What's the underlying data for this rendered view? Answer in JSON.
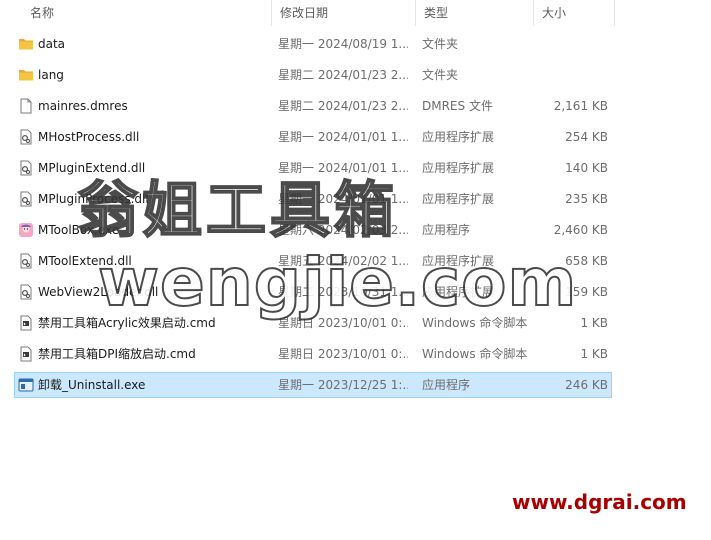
{
  "columns": {
    "name": "名称",
    "date": "修改日期",
    "type": "类型",
    "size": "大小"
  },
  "files": [
    {
      "name": "data",
      "date": "星期一 2024/08/19 1...",
      "type": "文件夹",
      "size": "",
      "icon": "folder-icon"
    },
    {
      "name": "lang",
      "date": "星期二 2024/01/23 2...",
      "type": "文件夹",
      "size": "",
      "icon": "folder-icon"
    },
    {
      "name": "mainres.dmres",
      "date": "星期二 2024/01/23 2...",
      "type": "DMRES 文件",
      "size": "2,161 KB",
      "icon": "file-icon"
    },
    {
      "name": "MHostProcess.dll",
      "date": "星期一 2024/01/01 1...",
      "type": "应用程序扩展",
      "size": "254 KB",
      "icon": "dll-icon"
    },
    {
      "name": "MPluginExtend.dll",
      "date": "星期一 2024/01/01 1...",
      "type": "应用程序扩展",
      "size": "140 KB",
      "icon": "dll-icon"
    },
    {
      "name": "MPluginProcess.dll",
      "date": "星期一 2024/01/01 1...",
      "type": "应用程序扩展",
      "size": "235 KB",
      "icon": "dll-icon"
    },
    {
      "name": "MToolBox.exe",
      "date": "星期六 2024/02/03 2...",
      "type": "应用程序",
      "size": "2,460 KB",
      "icon": "app-icon"
    },
    {
      "name": "MToolExtend.dll",
      "date": "星期五 2024/02/02 1...",
      "type": "应用程序扩展",
      "size": "658 KB",
      "icon": "dll-icon"
    },
    {
      "name": "WebView2Loader.dll",
      "date": "星期二 2023/10/31 1...",
      "type": "应用程序扩展",
      "size": "159 KB",
      "icon": "dll-icon"
    },
    {
      "name": "禁用工具箱Acrylic效果启动.cmd",
      "date": "星期日 2023/10/01 0:...",
      "type": "Windows 命令脚本",
      "size": "1 KB",
      "icon": "cmd-icon"
    },
    {
      "name": "禁用工具箱DPI缩放启动.cmd",
      "date": "星期日 2023/10/01 0:...",
      "type": "Windows 命令脚本",
      "size": "1 KB",
      "icon": "cmd-icon"
    },
    {
      "name": "卸载_Uninstall.exe",
      "date": "星期一 2023/12/25 1:...",
      "type": "应用程序",
      "size": "246 KB",
      "icon": "uninstall-app-icon",
      "selected": true
    }
  ],
  "watermarks": {
    "line1": "翁姐工具箱",
    "line2": "wengjie.com",
    "line3": "www.dgrai.com"
  },
  "colors": {
    "selected_bg": "#cce8ff",
    "selected_border": "#99d1ff",
    "folder": "#f5c542",
    "watermark_red": "#a80000"
  }
}
